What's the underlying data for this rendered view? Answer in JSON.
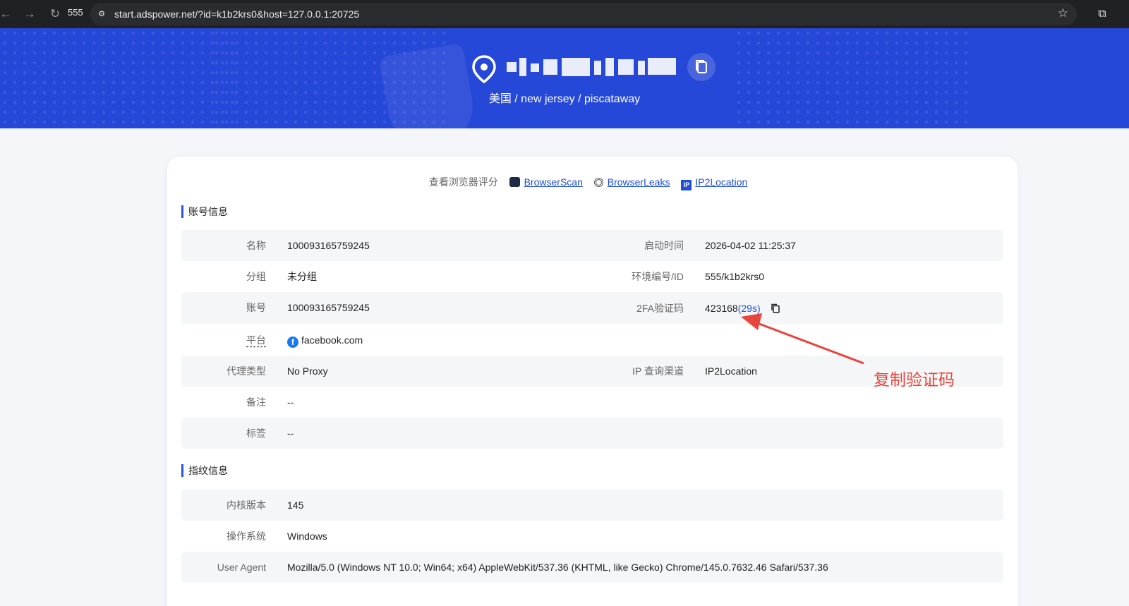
{
  "browser": {
    "tab_label": "555",
    "url": "start.adspower.net/?id=k1b2krs0&host=127.0.0.1:20725",
    "icons": [
      "back-icon",
      "forward-icon",
      "reload-icon",
      "site-settings-icon",
      "star-icon",
      "extensions-icon"
    ]
  },
  "header": {
    "location": "美国 / new jersey / piscataway",
    "ip_masked": true,
    "background_color": "#2648d8"
  },
  "scores": {
    "label": "查看浏览器评分",
    "links": [
      {
        "text": "BrowserScan",
        "icon": "browserscan-icon"
      },
      {
        "text": "BrowserLeaks",
        "icon": "browserleaks-icon"
      },
      {
        "text": "IP2Location",
        "icon": "ip2location-icon"
      }
    ]
  },
  "account": {
    "title": "账号信息",
    "name_label": "名称",
    "name": "100093165759245",
    "start_label": "启动时间",
    "start": "2026-04-02 11:25:37",
    "group_label": "分组",
    "group": "未分组",
    "env_label": "环境编号/ID",
    "env": "555/k1b2krs0",
    "acct_label": "账号",
    "acct": "100093165759245",
    "twofa_label": "2FA验证码",
    "twofa": "423168",
    "twofa_timer": "(29s)",
    "platform_label": "平台",
    "platform": "facebook.com",
    "proxy_label": "代理类型",
    "proxy": "No Proxy",
    "ipq_label": "IP 查询渠道",
    "ipq": "IP2Location",
    "note_label": "备注",
    "note": "--",
    "tag_label": "标签",
    "tag": "--"
  },
  "fingerprint": {
    "title": "指纹信息",
    "kernel_label": "内核版本",
    "kernel": "145",
    "os_label": "操作系统",
    "os": "Windows",
    "ua_label": "User Agent",
    "ua": "Mozilla/5.0 (Windows NT 10.0; Win64; x64) AppleWebKit/537.36 (KHTML, like Gecko) Chrome/145.0.7632.46 Safari/537.36"
  },
  "annotation": {
    "text": "复制验证码",
    "color": "#e8453c"
  },
  "colors": {
    "accent": "#2a52e0",
    "link": "#1e4fd8",
    "row_alt": "#f5f6f8"
  }
}
